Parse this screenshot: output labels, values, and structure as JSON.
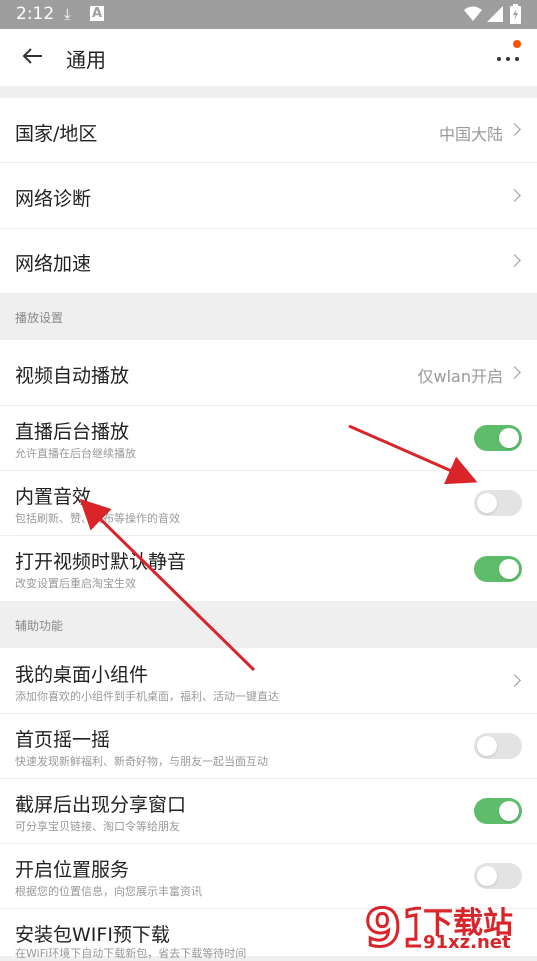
{
  "status_bar": {
    "time": "2:12",
    "icons": [
      "download-icon",
      "a-icon",
      "wifi-icon",
      "signal-icon",
      "battery-icon"
    ]
  },
  "app_bar": {
    "title": "通用",
    "back_icon": "arrow-left-icon",
    "more_icon": "more-dots-icon",
    "badge_color": "#ff5000"
  },
  "group1": [
    {
      "label": "国家/地区",
      "value": "中国大陆"
    },
    {
      "label": "网络诊断",
      "value": ""
    },
    {
      "label": "网络加速",
      "value": ""
    }
  ],
  "section_play": {
    "title": "播放设置"
  },
  "group2": [
    {
      "label": "视频自动播放",
      "value": "仅wlan开启"
    },
    {
      "label": "直播后台播放",
      "sub": "允许直播在后台继续播放",
      "toggle": true
    },
    {
      "label": "内置音效",
      "sub": "包括刷新、赞、发布等操作的音效",
      "toggle": false
    },
    {
      "label": "打开视频时默认静音",
      "sub": "改变设置后重启淘宝生效",
      "toggle": true
    }
  ],
  "section_assist": {
    "title": "辅助功能"
  },
  "group3": [
    {
      "label": "我的桌面小组件",
      "sub": "添加你喜欢的小组件到手机桌面，福利、活动一键直达"
    },
    {
      "label": "首页摇一摇",
      "sub": "快速发现新鲜福利、新奇好物，与朋友一起当面互动",
      "toggle": false
    },
    {
      "label": "截屏后出现分享窗口",
      "sub": "可分享宝贝链接、淘口令等给朋友",
      "toggle": true
    },
    {
      "label": "开启位置服务",
      "sub": "根据您的位置信息，向您展示丰富资讯",
      "toggle": false
    },
    {
      "label": "安装包WIFI预下载",
      "sub": "在WiFi环境下自动下载新包，省去下载等待时间"
    }
  ],
  "watermark": {
    "brand": "下载站",
    "url": "91xz.net",
    "logo_text": "91"
  },
  "colors": {
    "toggle_on": "#5ebd6a",
    "toggle_off": "#e3e3e3",
    "annotation_arrow": "#d9252a"
  }
}
